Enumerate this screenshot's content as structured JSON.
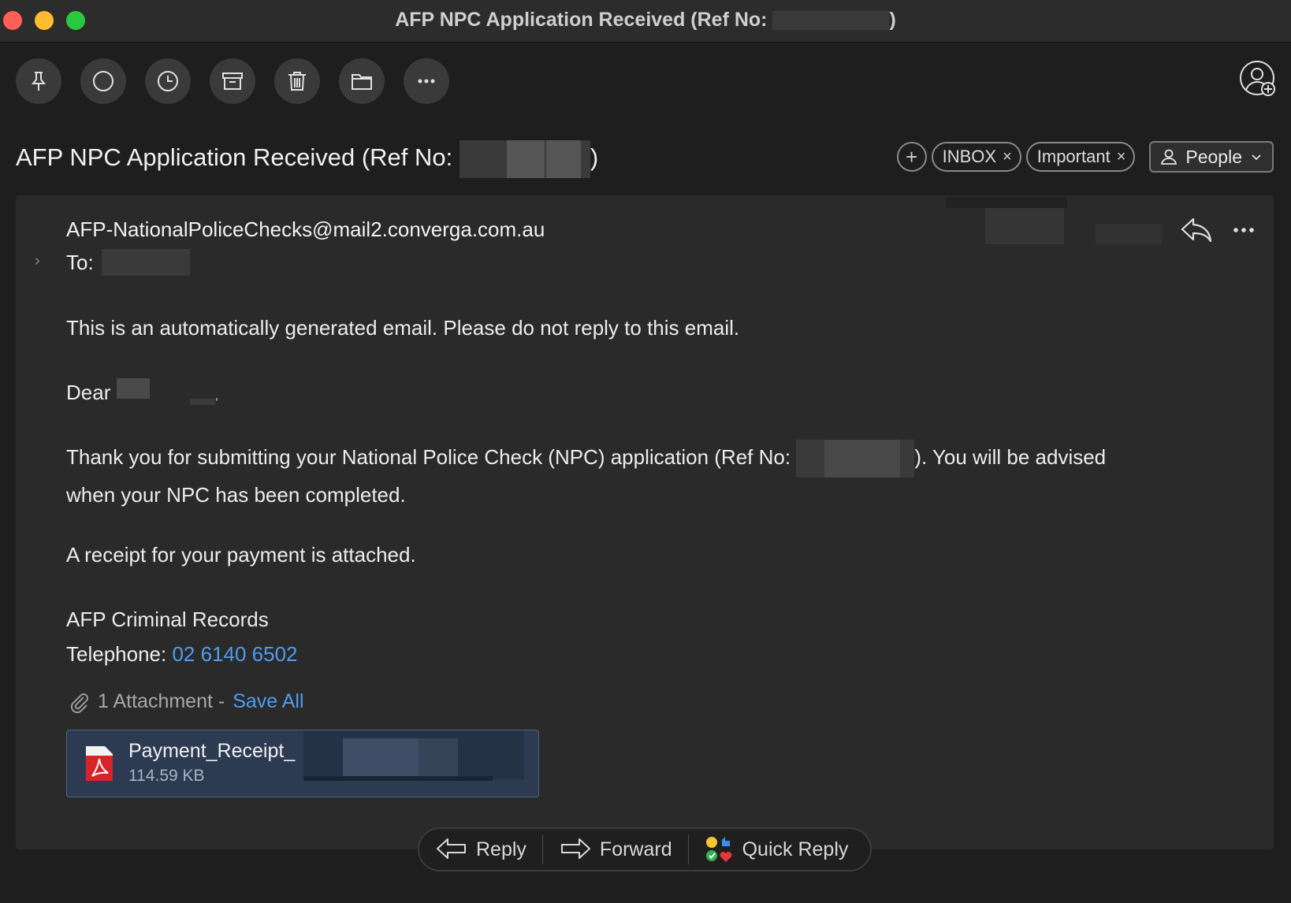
{
  "window": {
    "title_prefix": "AFP NPC Application Received (Ref No:",
    "title_suffix": ")"
  },
  "toolbar": {
    "buttons": [
      "pin",
      "mark-unread",
      "snooze",
      "archive",
      "delete",
      "move-to-folder",
      "more"
    ]
  },
  "subject": {
    "prefix": "AFP NPC Application Received (Ref No:",
    "suffix": ")"
  },
  "tags": {
    "add_symbol": "+",
    "items": [
      "INBOX",
      "Important"
    ],
    "remove_symbol": "×",
    "people_label": "People"
  },
  "message": {
    "from": "AFP-NationalPoliceChecks@mail2.converga.com.au",
    "to_label": "To:",
    "paragraph1": "This is an automatically generated email. Please do not reply to this email.",
    "greeting": "Dear",
    "greeting_comma": ",",
    "paragraph2_prefix": "Thank you for submitting your National Police Check (NPC) application (Ref No:",
    "paragraph2_suffix": "). You will be advised",
    "paragraph2_line2": "when your NPC has been completed.",
    "paragraph3": "A receipt for your payment is attached.",
    "signature_name": "AFP Criminal Records",
    "telephone_label": "Telephone:",
    "telephone_number": "02 6140 6502"
  },
  "attachments": {
    "count_label": "1 Attachment -",
    "save_all": "Save All",
    "file_name": "Payment_Receipt_",
    "file_size": "114.59 KB"
  },
  "actions": {
    "reply": "Reply",
    "forward": "Forward",
    "quick_reply": "Quick Reply"
  },
  "colors": {
    "link": "#4f9cf0",
    "background": "#1e1e1e",
    "card": "#2a2a2a",
    "attachment_card": "#2c3b52"
  }
}
